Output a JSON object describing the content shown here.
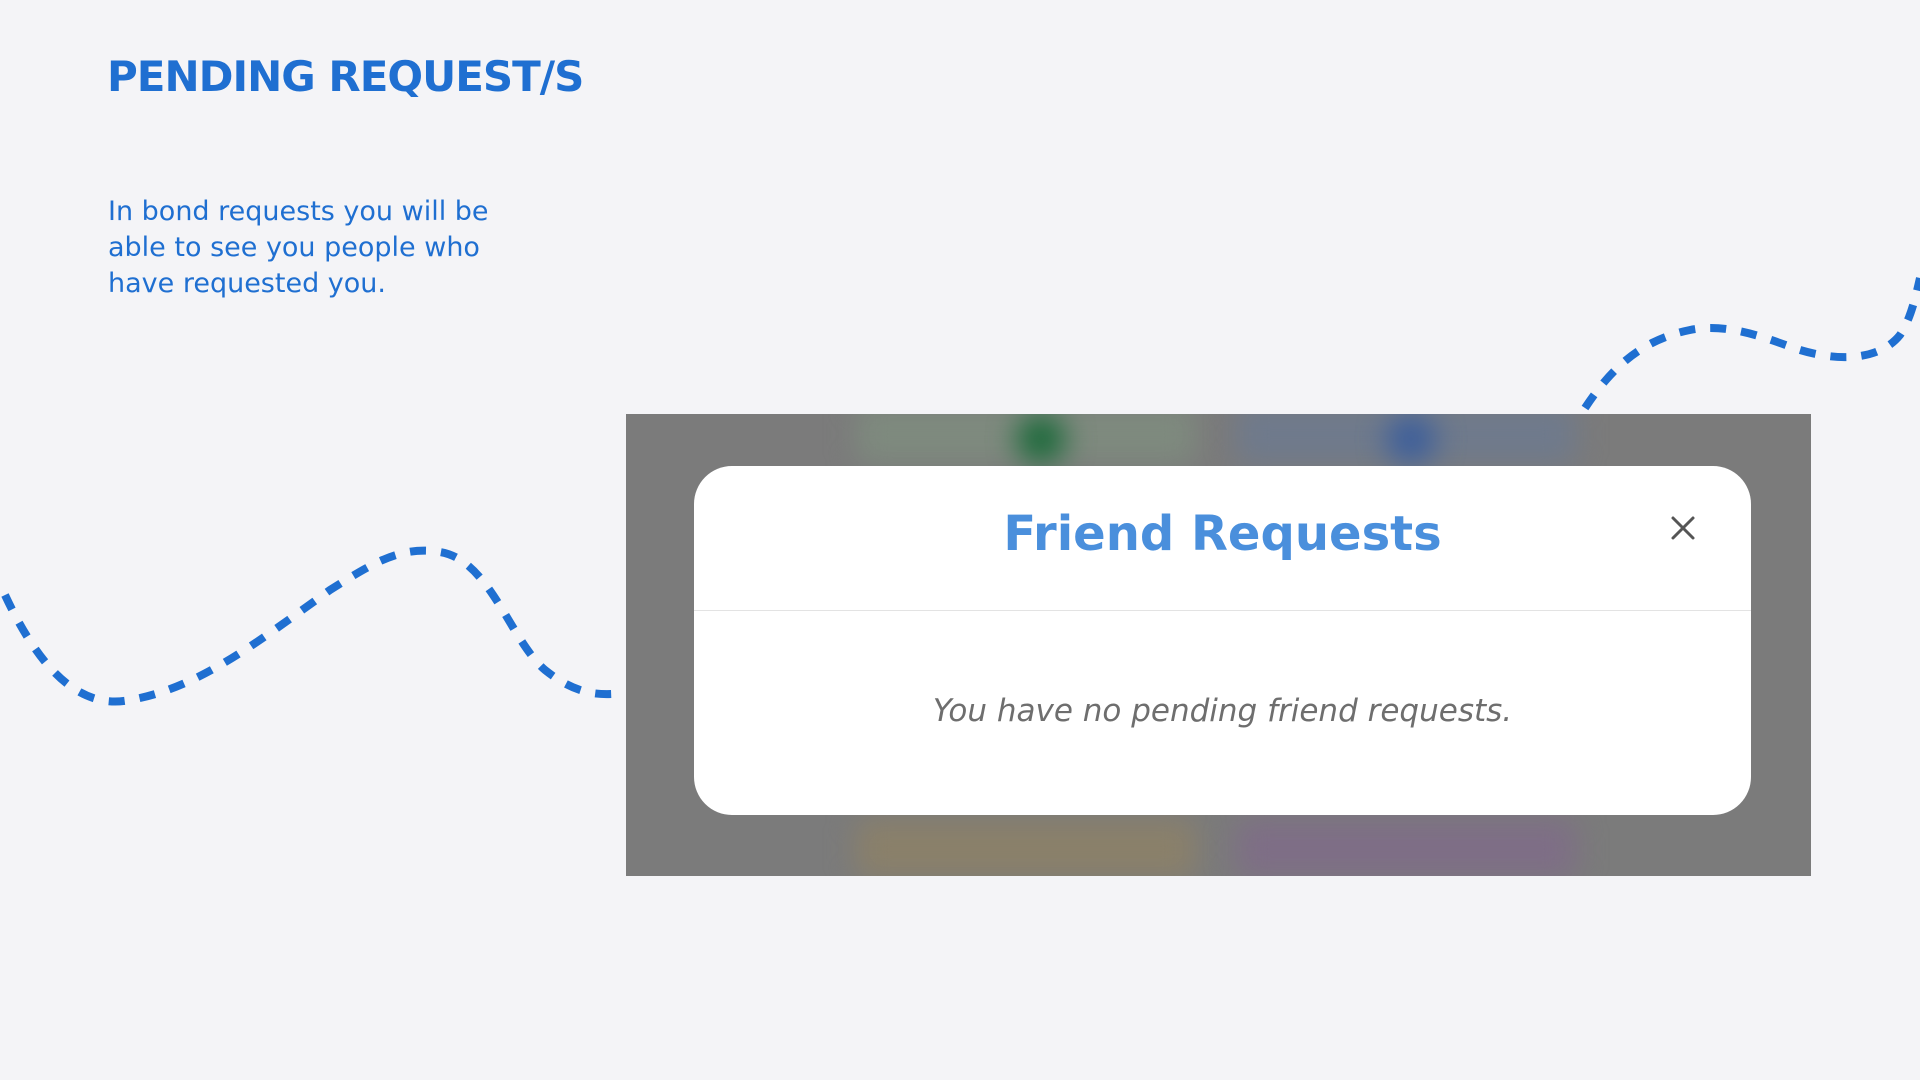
{
  "slide": {
    "title": "PENDING REQUEST/S",
    "description": "In bond requests you will be able to see you people who have requested you."
  },
  "modal": {
    "title": "Friend Requests",
    "close_icon": "close-icon",
    "empty_message": "You have no pending friend requests."
  },
  "colors": {
    "accent": "#1f6fd1",
    "modal_title": "#4a8fdc",
    "background": "#f4f4f7",
    "overlay": "#7b7b7b"
  }
}
